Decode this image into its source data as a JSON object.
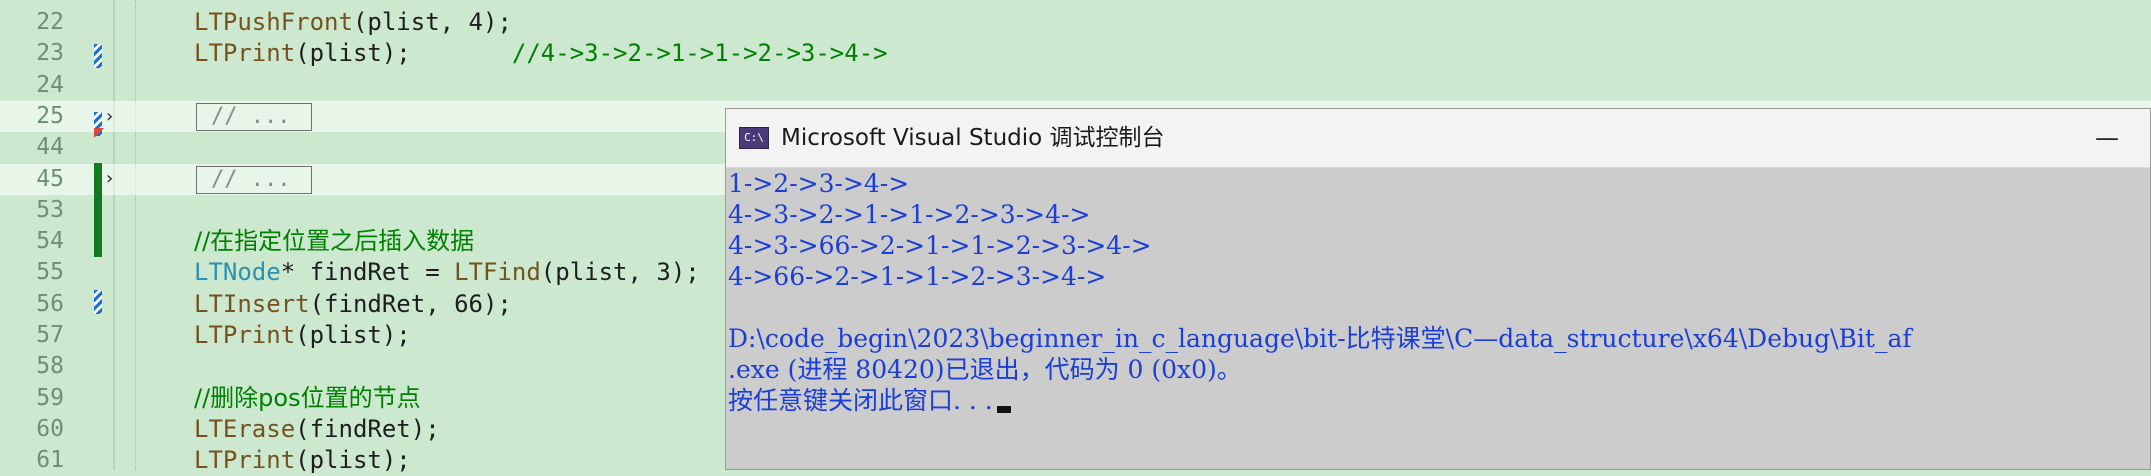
{
  "editor": {
    "lines": [
      {
        "num": "22",
        "code": [
          {
            "t": "fn",
            "v": "LTPushFront"
          },
          {
            "t": "p",
            "v": "(plist, 4);"
          }
        ]
      },
      {
        "num": "23",
        "code": [
          {
            "t": "fn",
            "v": "LTPrint"
          },
          {
            "t": "p",
            "v": "(plist);       "
          },
          {
            "t": "cm",
            "v": "//4->3->2->1->1->2->3->4->"
          }
        ]
      },
      {
        "num": "24",
        "code": []
      },
      {
        "num": "25",
        "fold": "// ..."
      },
      {
        "num": "44",
        "code": []
      },
      {
        "num": "45",
        "fold": "// ..."
      },
      {
        "num": "53",
        "code": []
      },
      {
        "num": "54",
        "code": [
          {
            "t": "cm-cjk",
            "v": "//在指定位置之后插入数据"
          }
        ]
      },
      {
        "num": "55",
        "code": [
          {
            "t": "ty",
            "v": "LTNode"
          },
          {
            "t": "p",
            "v": "* findRet = "
          },
          {
            "t": "fn",
            "v": "LTFind"
          },
          {
            "t": "p",
            "v": "(plist, 3);"
          }
        ]
      },
      {
        "num": "56",
        "code": [
          {
            "t": "fn",
            "v": "LTInsert"
          },
          {
            "t": "p",
            "v": "(findRet, 66);"
          }
        ]
      },
      {
        "num": "57",
        "code": [
          {
            "t": "fn",
            "v": "LTPrint"
          },
          {
            "t": "p",
            "v": "(plist);"
          }
        ]
      },
      {
        "num": "58",
        "code": []
      },
      {
        "num": "59",
        "code": [
          {
            "t": "cm-cjk",
            "v": "//删除pos位置的节点"
          }
        ]
      },
      {
        "num": "60",
        "code": [
          {
            "t": "fn",
            "v": "LTErase"
          },
          {
            "t": "p",
            "v": "(findRet);"
          }
        ]
      },
      {
        "num": "61",
        "code": [
          {
            "t": "fn",
            "v": "LTPrint"
          },
          {
            "t": "p",
            "v": "(plist);"
          }
        ]
      }
    ],
    "colors": {
      "background": "#cce8cf",
      "function": "#74531f",
      "type": "#2b91af",
      "comment": "#008000",
      "line_number": "#6e8f75"
    }
  },
  "console": {
    "icon_text": "C:\\",
    "title": "Microsoft Visual Studio 调试控制台",
    "minimize_label": "—",
    "output_lines": [
      "1->2->3->4->",
      "4->3->2->1->1->2->3->4->",
      "4->3->66->2->1->1->2->3->4->",
      "4->66->2->1->1->2->3->4->",
      "",
      "D:\\code_begin\\2023\\beginner_in_c_language\\bit-比特课堂\\C—data_structure\\x64\\Debug\\Bit_af",
      ".exe (进程 80420)已退出，代码为 0 (0x0)。",
      "按任意键关闭此窗口. . ."
    ],
    "text_color": "#1b3ed6",
    "background": "#cccccc"
  }
}
